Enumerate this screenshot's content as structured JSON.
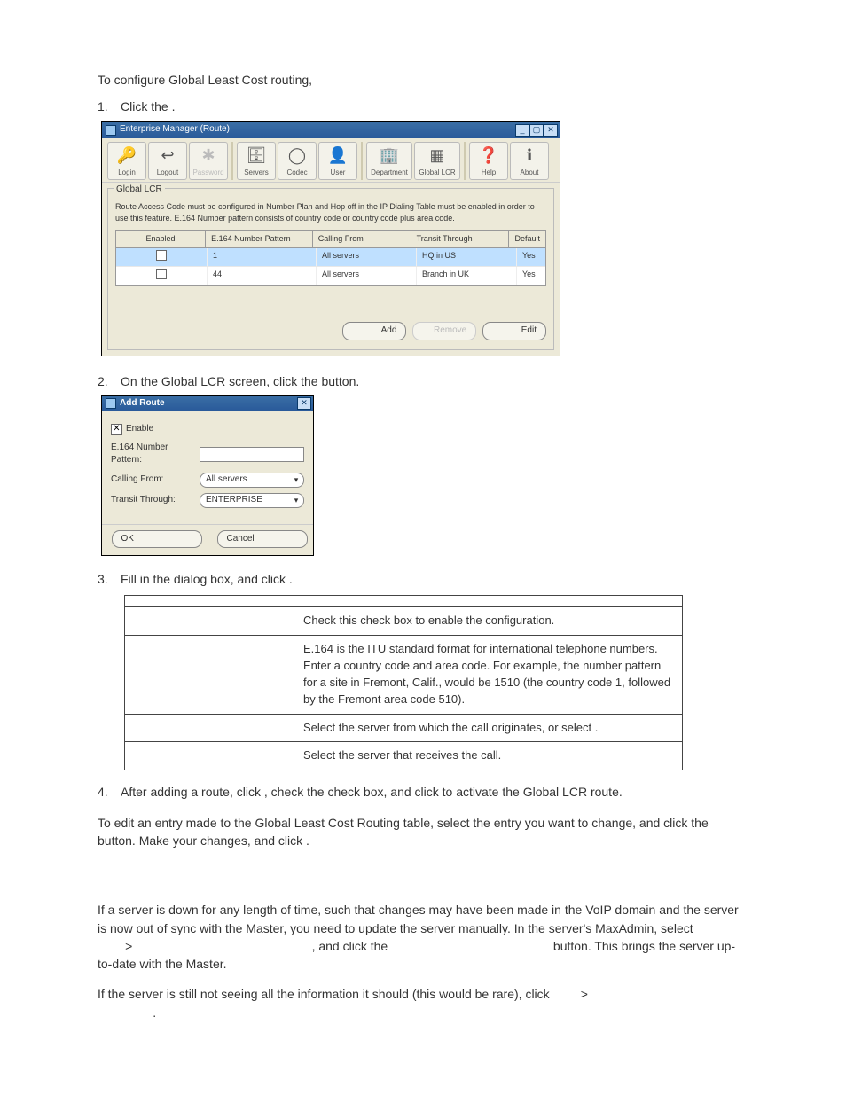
{
  "intro": "To configure Global Least Cost routing,",
  "steps": {
    "s1_a": "Click the ",
    "s1_b": ".",
    "s2_a": "On the Global LCR screen, click the ",
    "s2_b": " button.",
    "s3_a": "Fill in the dialog box, and click ",
    "s3_b": ".",
    "s4_a": "After adding a route, click ",
    "s4_b": ", check the ",
    "s4_c": " check box, and click ",
    "s4_d": " to activate the Global LCR route."
  },
  "em_window": {
    "title": "Enterprise Manager  (Route)",
    "toolbar": {
      "login": "Login",
      "logout": "Logout",
      "password": "Password",
      "servers": "Servers",
      "codec": "Codec",
      "user": "User",
      "department": "Department",
      "globallcr": "Global LCR",
      "help": "Help",
      "about": "About"
    },
    "panel_title": "Global LCR",
    "helptext": "Route Access Code must be configured in Number Plan and Hop off in the IP Dialing Table must be enabled in order to use this feature. E.164 Number pattern consists of country code or country code plus area code.",
    "columns": {
      "enabled": "Enabled",
      "pattern": "E.164 Number Pattern",
      "from": "Calling From",
      "tt": "Transit Through",
      "def": "Default"
    },
    "rows": [
      {
        "pattern": "1",
        "from": "All servers",
        "tt": "HQ in US",
        "def": "Yes"
      },
      {
        "pattern": "44",
        "from": "All servers",
        "tt": "Branch in UK",
        "def": "Yes"
      }
    ],
    "buttons": {
      "add": "Add",
      "remove": "Remove",
      "edit": "Edit"
    }
  },
  "dlg": {
    "title": "Add Route",
    "enable": "Enable",
    "pattern": "E.164 Number Pattern:",
    "from": "Calling From:",
    "from_val": "All servers",
    "tt": "Transit Through:",
    "tt_val": "ENTERPRISE",
    "ok": "OK",
    "cancel": "Cancel"
  },
  "table": {
    "r1c2": "Check this check box to enable the configuration.",
    "r2c2": "E.164 is the ITU standard format for international telephone numbers. Enter a country code and area code. For example, the number pattern for a site in Fremont, Calif., would be 1510 (the country code 1, followed by the Fremont area code 510).",
    "r3c2a": "Select the server from which the call originates, or select ",
    "r3c2b": ".",
    "r4c2": "Select the server that receives the call."
  },
  "postedit_a": "To edit an entry made to the Global Least Cost Routing table, select the entry you want to change, and click the ",
  "postedit_b": " button. Make your changes, and click ",
  "postedit_c": ".",
  "sync": {
    "p1a": "If a server is down for any length of time, such that changes may have been made in the VoIP domain and the server is now out of sync with the Master, you need to update the server manually. In the server's MaxAdmin, select ",
    "gt1": ">",
    "p1b": ", and click the ",
    "p1c": " button. This brings the server up-to-date with the Master.",
    "p2a": "If the server is still not seeing all the information it should (this would be rare), click ",
    "gt2": ">",
    "p2b": "."
  }
}
